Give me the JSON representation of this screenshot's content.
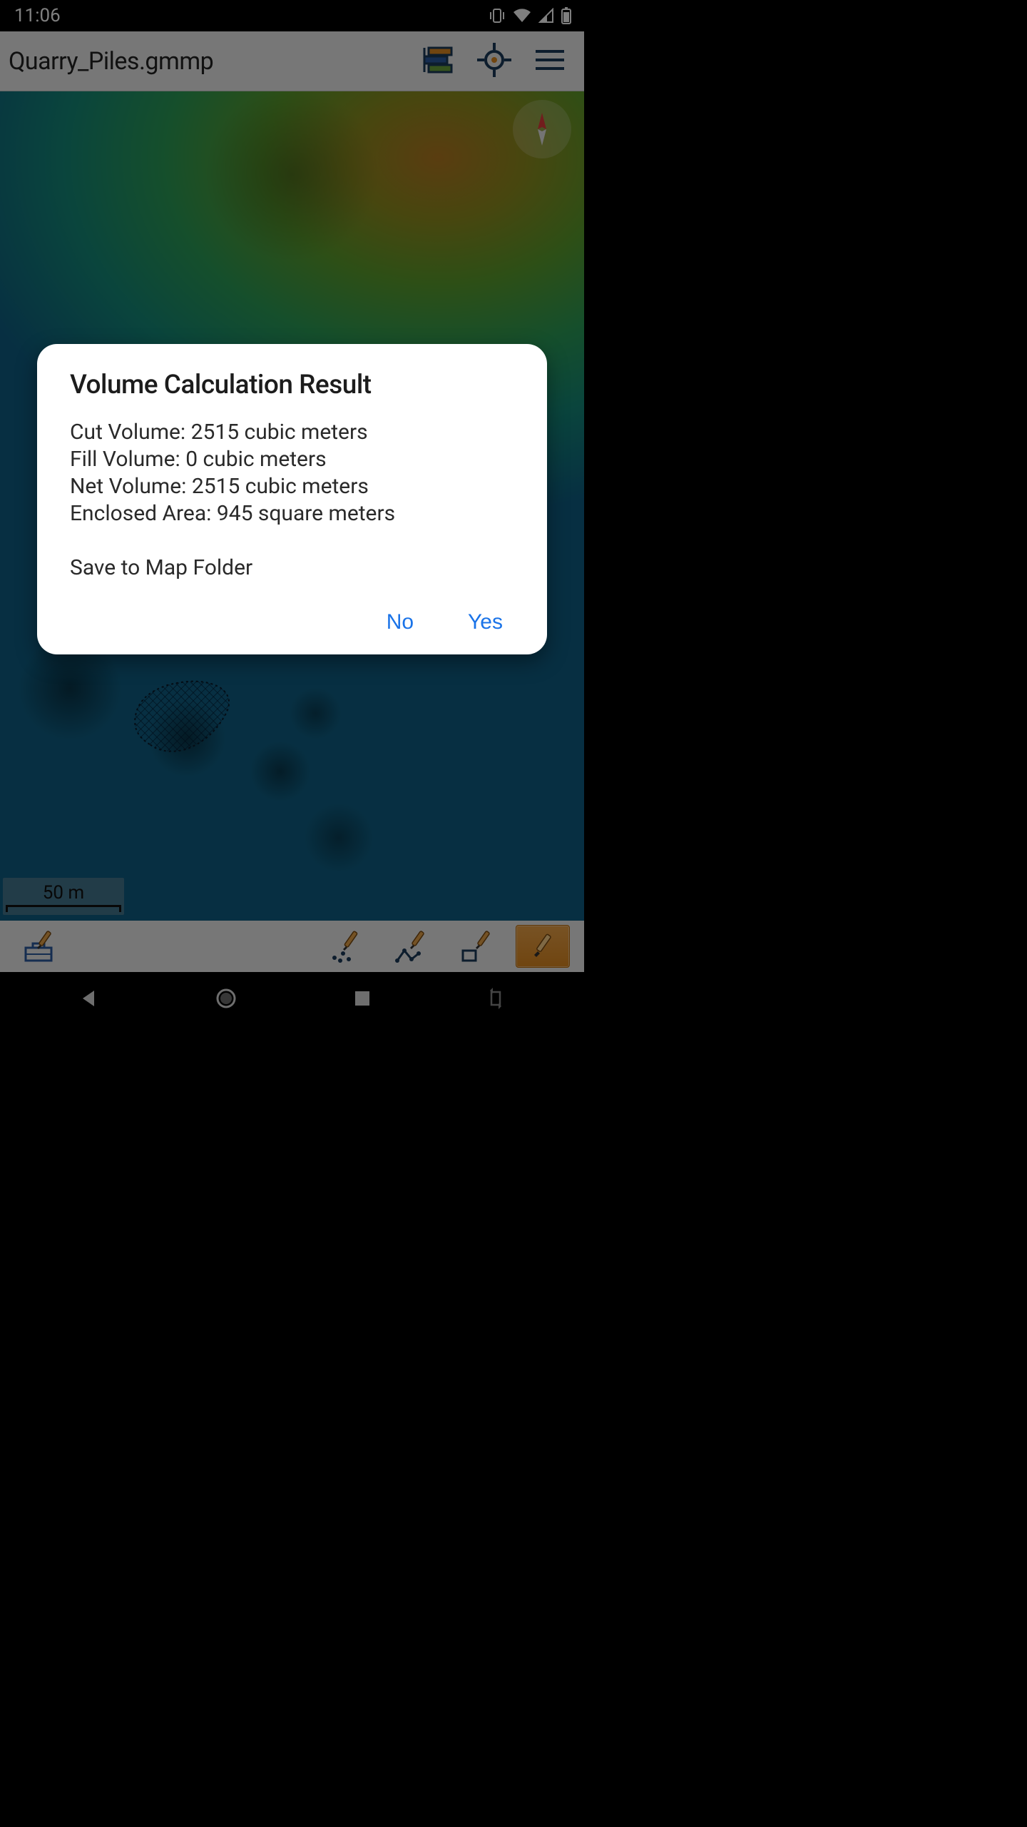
{
  "statusbar": {
    "time": "11:06"
  },
  "appbar": {
    "title": "Quarry_Piles.gmmp"
  },
  "dialog": {
    "title": "Volume Calculation Result",
    "lines": {
      "cut": "Cut Volume: 2515 cubic meters",
      "fill": "Fill Volume: 0 cubic meters",
      "net": "Net Volume: 2515 cubic meters",
      "area": "Enclosed Area: 945 square meters"
    },
    "prompt": "Save to Map Folder",
    "actions": {
      "no": "No",
      "yes": "Yes"
    }
  },
  "scalebar": {
    "label": "50 m"
  }
}
